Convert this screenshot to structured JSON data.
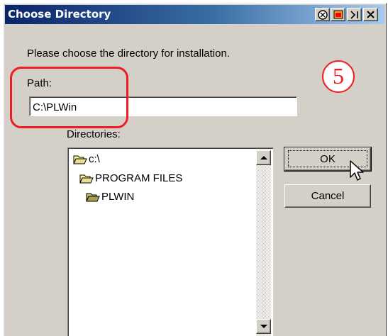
{
  "window": {
    "title": "Choose Directory",
    "controls": [
      "help-icon",
      "restore-icon",
      "help-question-icon",
      "close-icon"
    ]
  },
  "instruction": "Please choose the directory for installation.",
  "path": {
    "label": "Path:",
    "value": "C:\\PLWin"
  },
  "directories": {
    "label": "Directories:",
    "items": [
      {
        "label": "c:\\",
        "icon": "open-folder-icon"
      },
      {
        "label": "PROGRAM FILES",
        "icon": "open-folder-icon"
      },
      {
        "label": "PLWIN",
        "icon": "open-folder-icon"
      }
    ]
  },
  "buttons": {
    "ok": "OK",
    "cancel": "Cancel"
  },
  "annotation": {
    "step": "5",
    "color": "#ee1c24"
  },
  "colors": {
    "titlebar_start": "#0a246a",
    "titlebar_end": "#a6caf0",
    "face": "#d4d0c8"
  }
}
